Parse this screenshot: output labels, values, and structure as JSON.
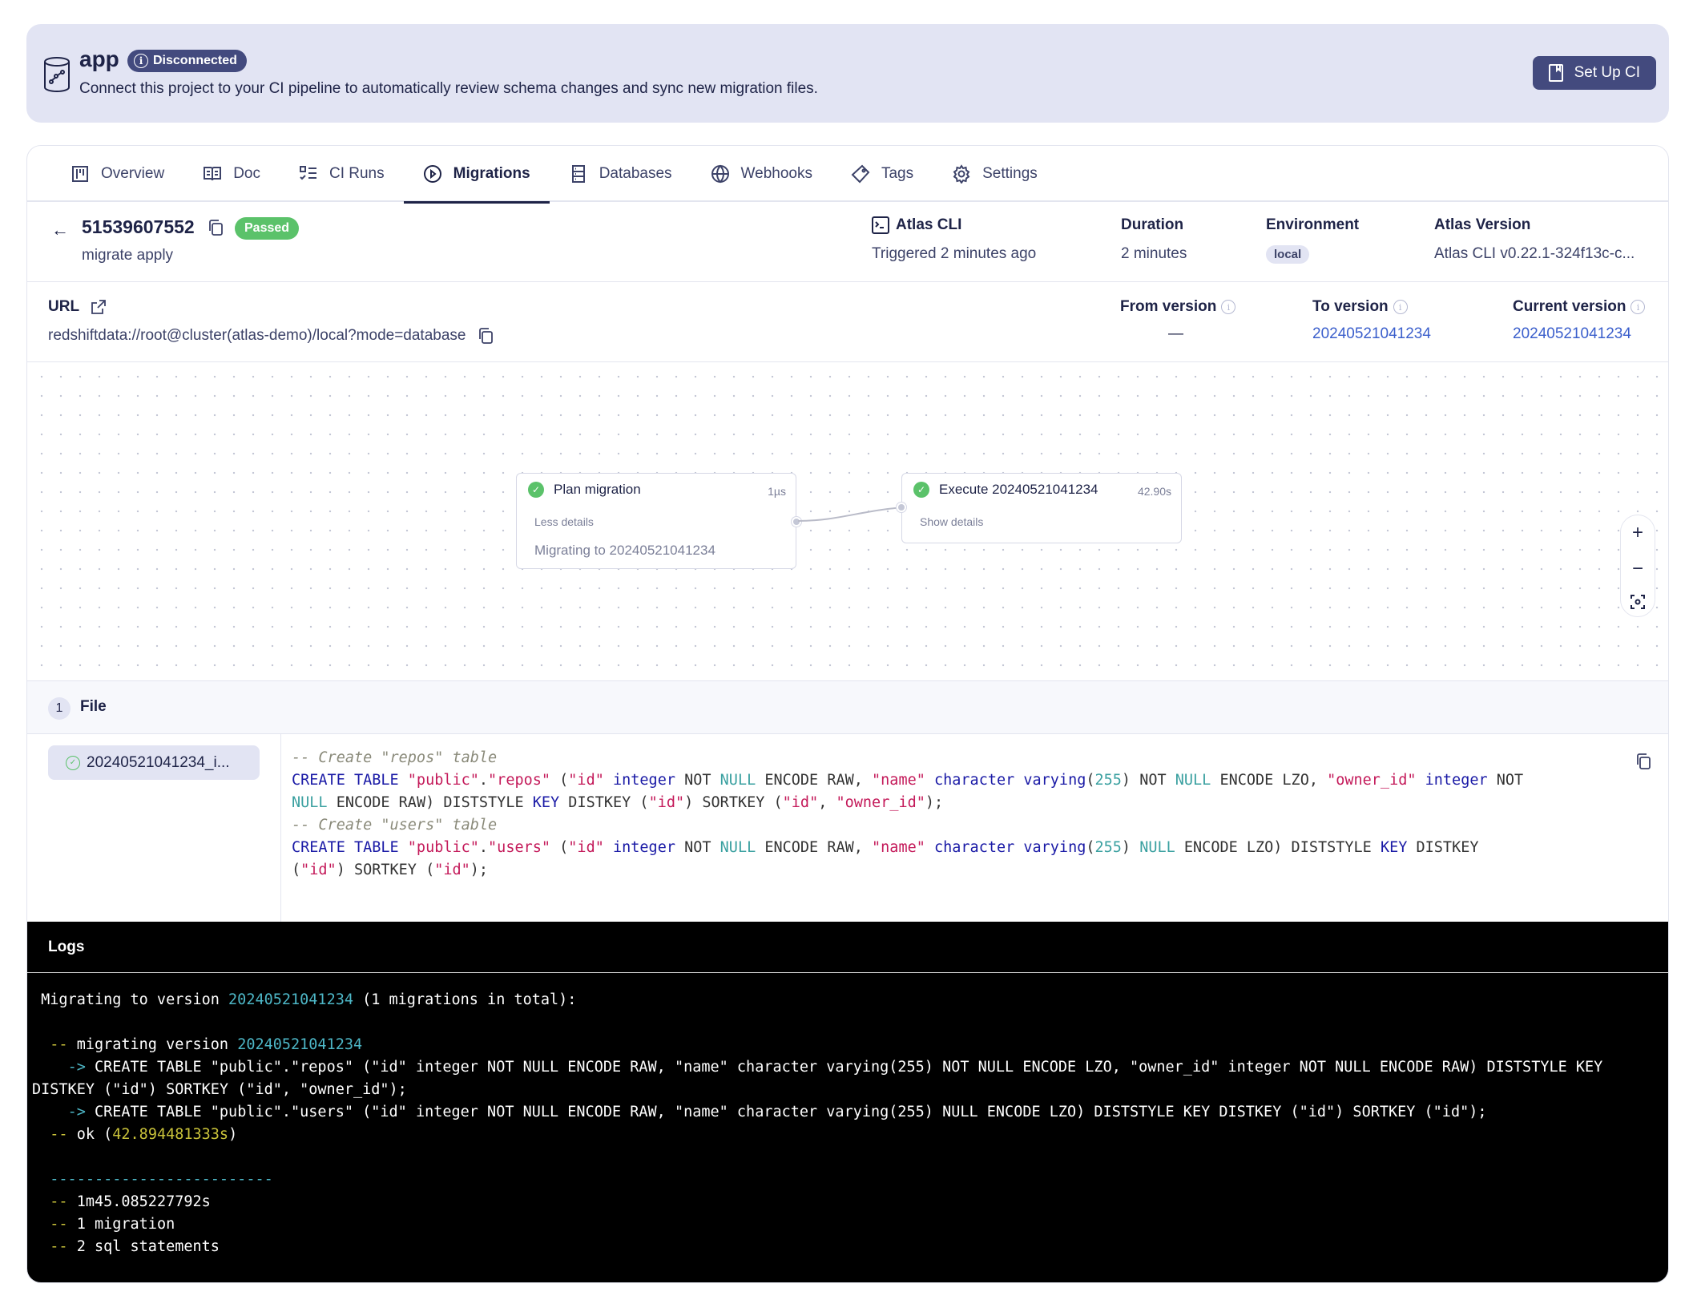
{
  "banner": {
    "project_name": "app",
    "status_badge": "Disconnected",
    "description": "Connect this project to your CI pipeline to automatically review schema changes and sync new migration files.",
    "setup_button": "Set Up CI"
  },
  "tabs": [
    {
      "label": "Overview",
      "icon": "board-icon",
      "active": false
    },
    {
      "label": "Doc",
      "icon": "book-icon",
      "active": false
    },
    {
      "label": "CI Runs",
      "icon": "checklist-icon",
      "active": false
    },
    {
      "label": "Migrations",
      "icon": "play-circle-icon",
      "active": true
    },
    {
      "label": "Databases",
      "icon": "server-icon",
      "active": false
    },
    {
      "label": "Webhooks",
      "icon": "globe-icon",
      "active": false
    },
    {
      "label": "Tags",
      "icon": "tag-icon",
      "active": false
    },
    {
      "label": "Settings",
      "icon": "gear-icon",
      "active": false
    }
  ],
  "run": {
    "id": "51539607552",
    "status": "Passed",
    "command": "migrate apply",
    "source_label": "Atlas CLI",
    "triggered": "Triggered 2 minutes ago",
    "duration_label": "Duration",
    "duration": "2 minutes",
    "environment_label": "Environment",
    "environment": "local",
    "atlas_version_label": "Atlas Version",
    "atlas_version": "Atlas CLI v0.22.1-324f13c-c..."
  },
  "url": {
    "label": "URL",
    "value": "redshiftdata://root@cluster(atlas-demo)/local?mode=database"
  },
  "versions": {
    "from_label": "From version",
    "from_value": "—",
    "to_label": "To version",
    "to_value": "20240521041234",
    "current_label": "Current version",
    "current_value": "20240521041234"
  },
  "flow": {
    "plan": {
      "title": "Plan migration",
      "duration": "1µs",
      "toggle": "Less details",
      "detail": "Migrating to 20240521041234"
    },
    "execute": {
      "title": "Execute 20240521041234",
      "duration": "42.90s",
      "toggle": "Show details"
    },
    "zoom_in": "+",
    "zoom_out": "−"
  },
  "files": {
    "count": "1",
    "title": "File",
    "items": [
      {
        "name": "20240521041234_i..."
      }
    ]
  },
  "logs": {
    "title": "Logs",
    "summary_version": "20240521041234",
    "ok_time": "42.894481333s",
    "total_time": "1m45.085227792s",
    "migrations": "1 migration",
    "statements": "2 sql statements"
  }
}
